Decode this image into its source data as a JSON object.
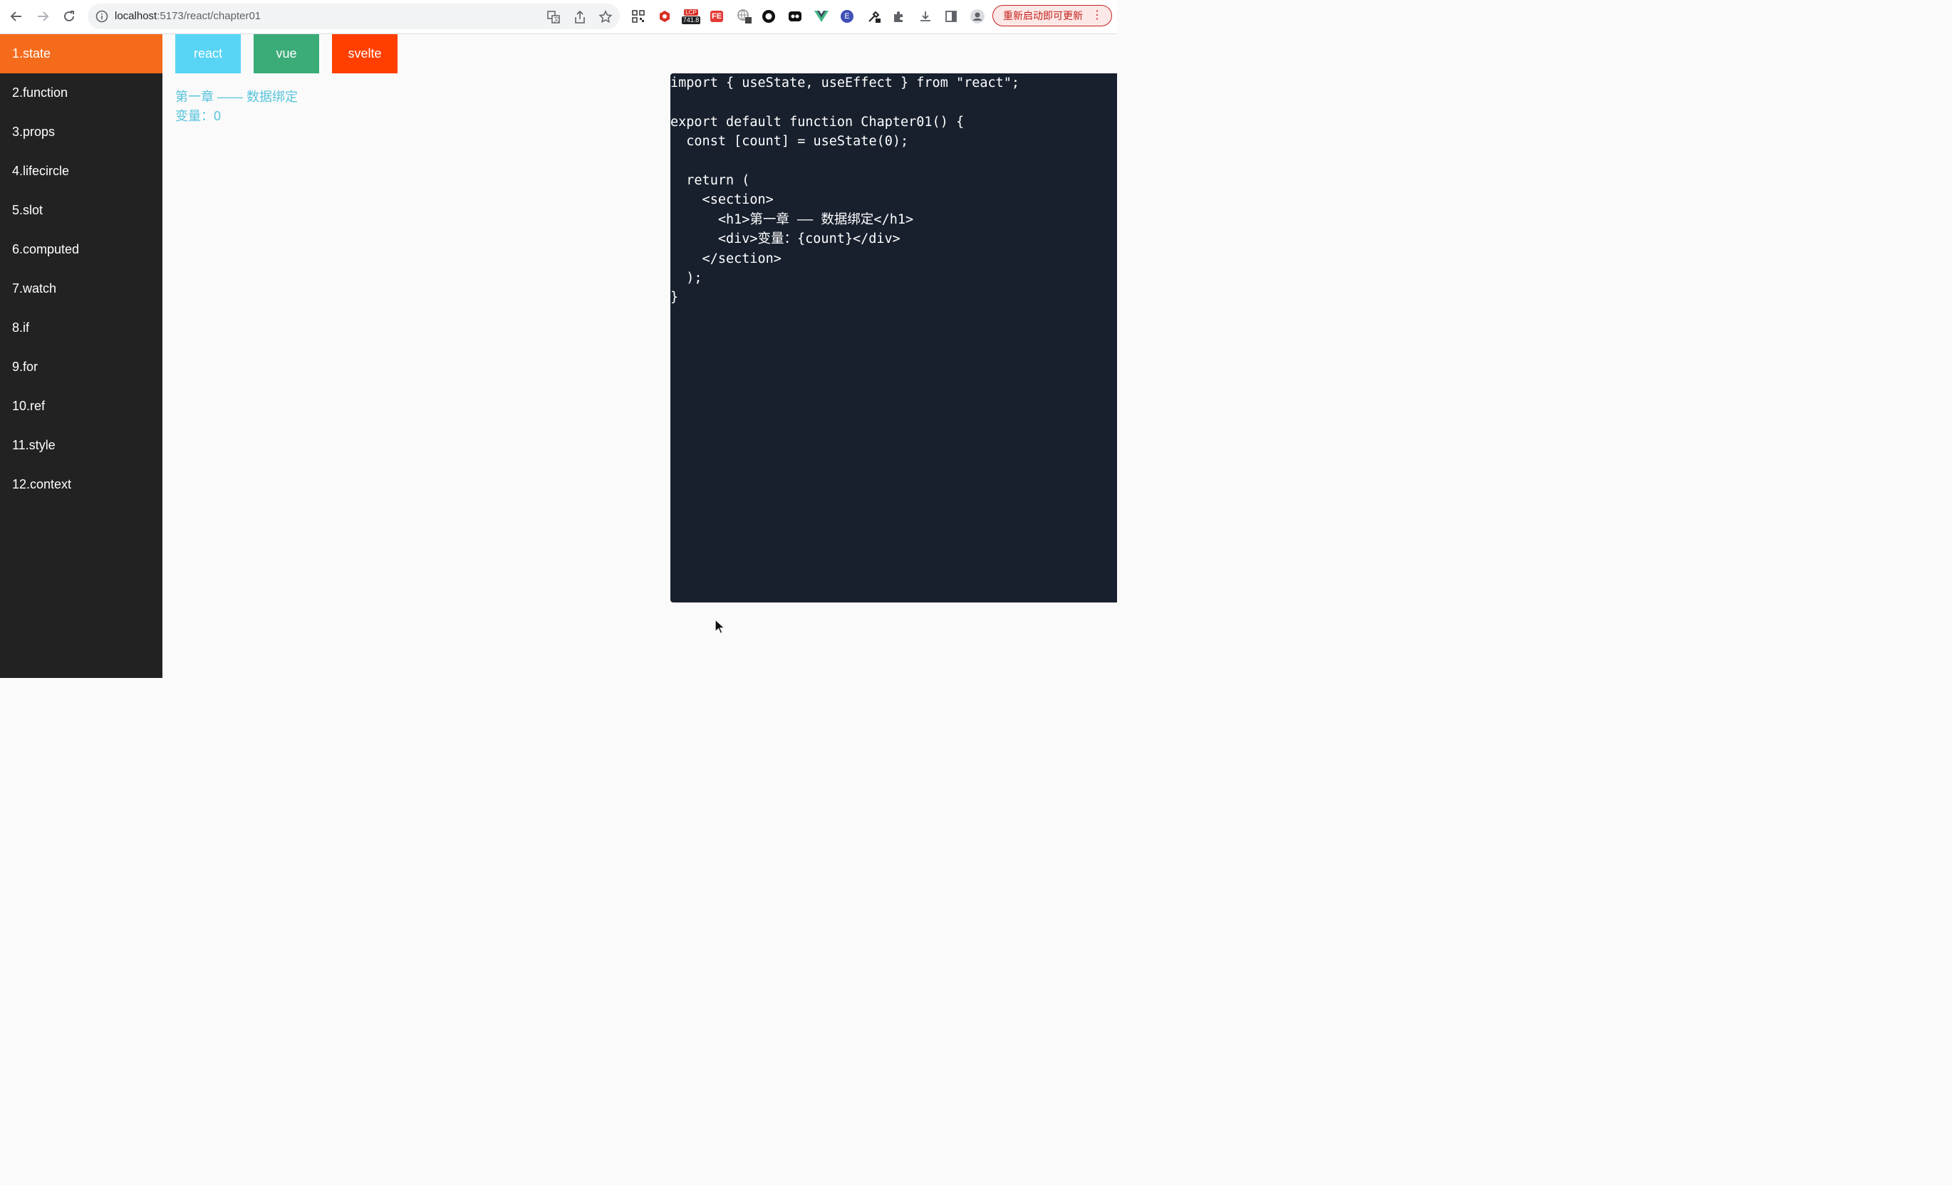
{
  "browser": {
    "url_host": "localhost",
    "url_path": ":5173/react/chapter01",
    "lcp_badge_label": "LCP",
    "lcp_badge_value": "741.8",
    "fe_badge": "FE",
    "e_badge": "E",
    "update_button_label": "重新启动即可更新",
    "menu_dots": "⋮"
  },
  "sidebar": {
    "items": [
      {
        "label": "1.state",
        "active": true
      },
      {
        "label": "2.function"
      },
      {
        "label": "3.props"
      },
      {
        "label": "4.lifecircle"
      },
      {
        "label": "5.slot"
      },
      {
        "label": "6.computed"
      },
      {
        "label": "7.watch"
      },
      {
        "label": "8.if"
      },
      {
        "label": "9.for"
      },
      {
        "label": "10.ref"
      },
      {
        "label": "11.style"
      },
      {
        "label": "12.context"
      }
    ]
  },
  "frameworks": {
    "react": "react",
    "vue": "vue",
    "svelte": "svelte"
  },
  "content": {
    "heading": "第一章 —— 数据绑定",
    "count_line": "变量：0"
  },
  "code": {
    "lines": [
      "import { useState, useEffect } from \"react\";",
      "",
      "export default function Chapter01() {",
      "  const [count] = useState(0);",
      "",
      "  return (",
      "    <section>",
      "      <h1>第一章 —— 数据绑定</h1>",
      "      <div>变量：{count}</div>",
      "    </section>",
      "  );",
      "}"
    ]
  },
  "colors": {
    "sidebar_bg": "#222222",
    "active_item": "#f46b1c",
    "react": "#58d4f5",
    "vue": "#3bab78",
    "svelte": "#ff3e00",
    "heading_text": "#58c4dc",
    "code_bg": "#18202e"
  }
}
